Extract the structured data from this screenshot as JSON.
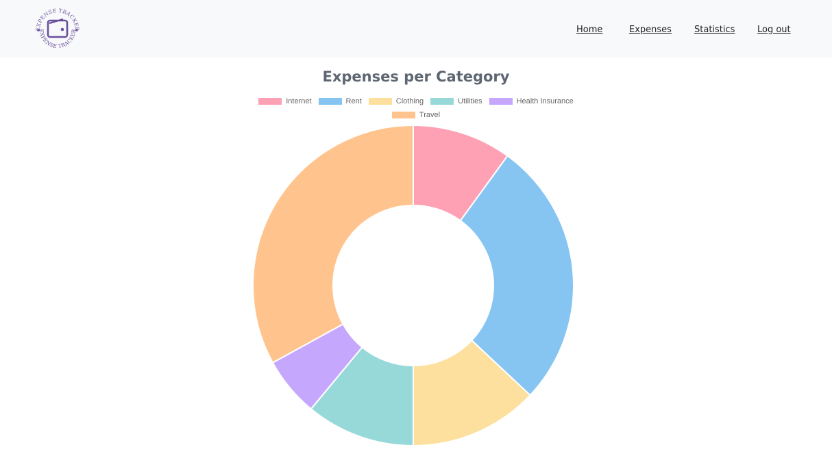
{
  "nav": {
    "logo_text": "EXPENSE TRACKER",
    "links": [
      "Home",
      "Expenses",
      "Statistics",
      "Log out"
    ]
  },
  "chart_data": {
    "type": "pie",
    "variant": "doughnut",
    "title": "Expenses per Category",
    "categories": [
      "Internet",
      "Rent",
      "Clothing",
      "Utilities",
      "Health Insurance",
      "Travel"
    ],
    "values": [
      10,
      27,
      13,
      11,
      6,
      33
    ],
    "colors": [
      "#ffa1b5",
      "#86c5f2",
      "#fde09e",
      "#97d9d9",
      "#c6a7fe",
      "#ffc48e"
    ],
    "legend_position": "top"
  }
}
